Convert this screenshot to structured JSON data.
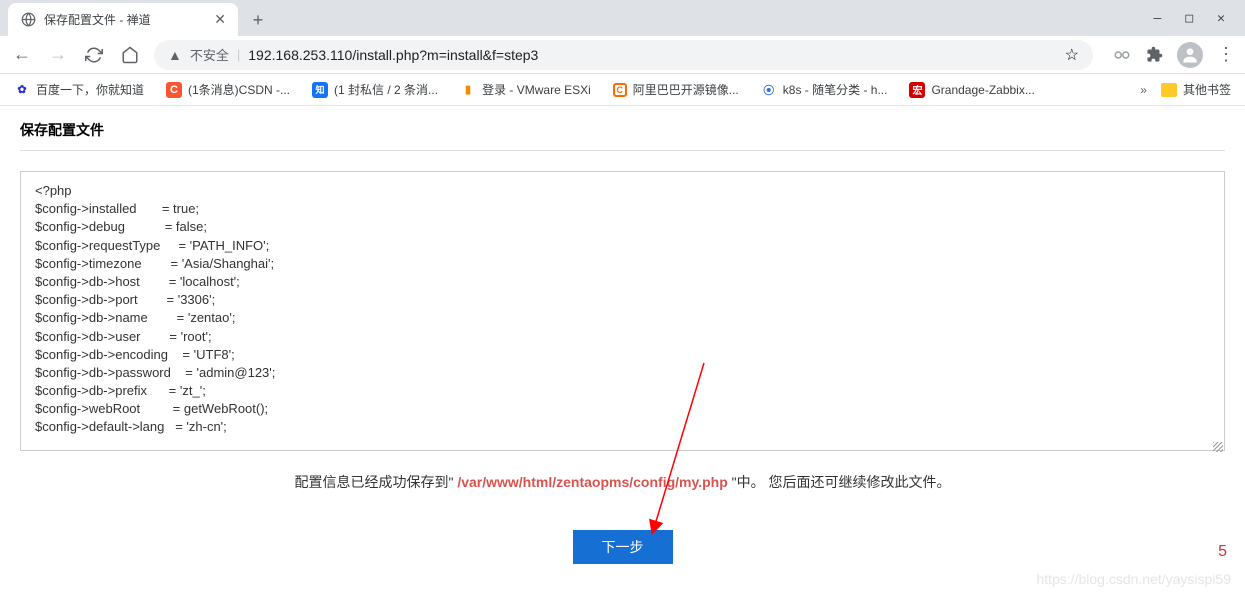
{
  "window": {
    "minimize": "—",
    "maximize": "□",
    "close": "✕"
  },
  "tab": {
    "title": "保存配置文件 - 禅道"
  },
  "nav": {
    "insecure_label": "不安全",
    "url": "192.168.253.110/install.php?m=install&f=step3"
  },
  "bookmarks": {
    "items": [
      {
        "label": "百度一下，你就知道"
      },
      {
        "label": "(1条消息)CSDN -..."
      },
      {
        "label": "(1 封私信 / 2 条消..."
      },
      {
        "label": "登录 - VMware ESXi"
      },
      {
        "label": "阿里巴巴开源镜像..."
      },
      {
        "label": "k8s - 随笔分类 - h..."
      },
      {
        "label": "Grandage-Zabbix..."
      }
    ],
    "other": "其他书签"
  },
  "page": {
    "title": "保存配置文件",
    "config_text": "<?php\n$config->installed       = true;\n$config->debug           = false;\n$config->requestType     = 'PATH_INFO';\n$config->timezone        = 'Asia/Shanghai';\n$config->db->host        = 'localhost';\n$config->db->port        = '3306';\n$config->db->name        = 'zentao';\n$config->db->user        = 'root';\n$config->db->encoding    = 'UTF8';\n$config->db->password    = 'admin@123';\n$config->db->prefix      = 'zt_';\n$config->webRoot         = getWebRoot();\n$config->default->lang   = 'zh-cn';",
    "status_prefix": "配置信息已经成功保存到\" ",
    "status_path": "/var/www/html/zentaopms/config/my.php",
    "status_suffix": " \"中。 您后面还可继续修改此文件。",
    "next_button": "下一步",
    "page_number": "5",
    "watermark": "https://blog.csdn.net/yaysispi59"
  }
}
